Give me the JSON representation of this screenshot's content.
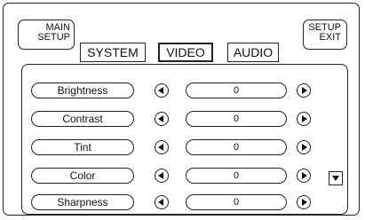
{
  "header": {
    "main_setup": [
      "MAIN",
      "SETUP"
    ],
    "setup_exit": [
      "SETUP",
      "EXIT"
    ]
  },
  "tabs": [
    "SYSTEM",
    "VIDEO",
    "AUDIO"
  ],
  "active_tab": "VIDEO",
  "settings": [
    {
      "label": "Brightness",
      "value": "0"
    },
    {
      "label": "Contrast",
      "value": "0"
    },
    {
      "label": "Tint",
      "value": "0"
    },
    {
      "label": "Color",
      "value": "0"
    },
    {
      "label": "Sharpness",
      "value": "0"
    }
  ],
  "icons": {
    "decrease": "left-arrow-icon",
    "increase": "right-arrow-icon",
    "scroll": "down-arrow-icon"
  }
}
